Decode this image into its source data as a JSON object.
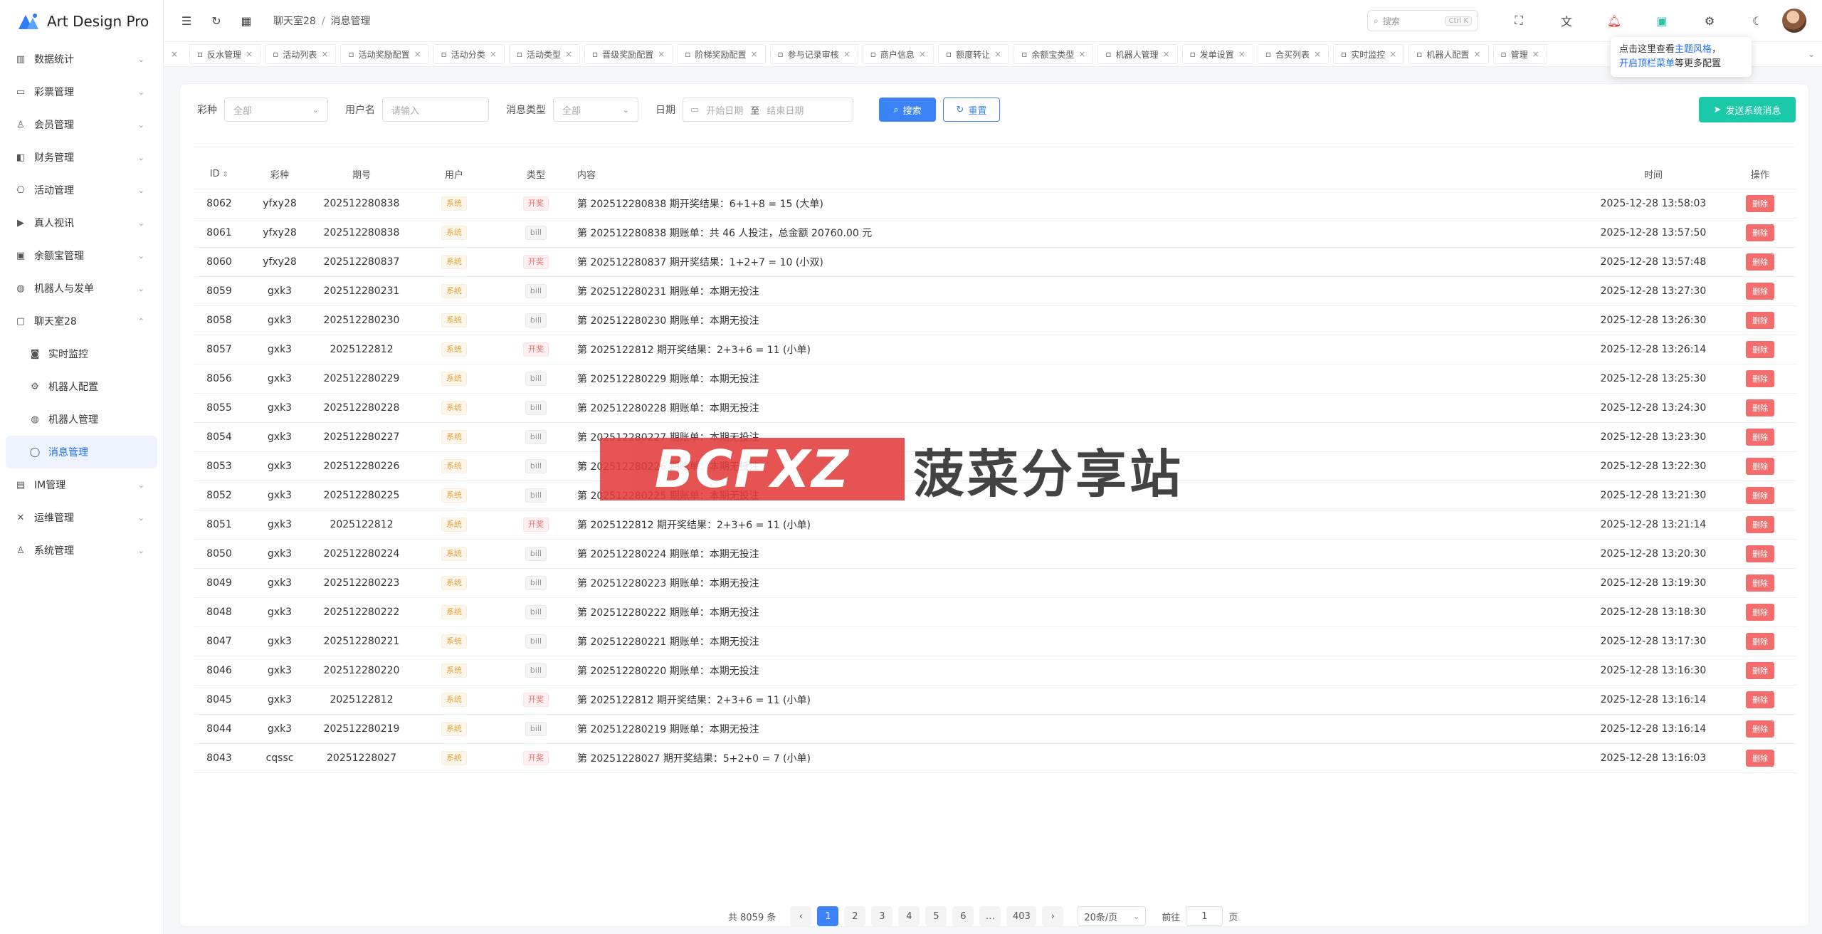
{
  "app": {
    "title": "Art Design Pro"
  },
  "sidebar": {
    "items": [
      {
        "label": "数据统计",
        "icon": "chart-icon",
        "expanded": false
      },
      {
        "label": "彩票管理",
        "icon": "ticket-icon",
        "expanded": false
      },
      {
        "label": "会员管理",
        "icon": "user-icon",
        "expanded": false
      },
      {
        "label": "财务管理",
        "icon": "wallet-icon",
        "expanded": false
      },
      {
        "label": "活动管理",
        "icon": "gift-icon",
        "expanded": false
      },
      {
        "label": "真人视讯",
        "icon": "video-icon",
        "expanded": false
      },
      {
        "label": "余额宝管理",
        "icon": "safe-icon",
        "expanded": false
      },
      {
        "label": "机器人与发单",
        "icon": "robot-icon",
        "expanded": false
      },
      {
        "label": "聊天室28",
        "icon": "chat-icon",
        "expanded": true
      }
    ],
    "sub_items": [
      {
        "label": "实时监控",
        "icon": "camera-icon"
      },
      {
        "label": "机器人配置",
        "icon": "gear-icon"
      },
      {
        "label": "机器人管理",
        "icon": "robot-icon"
      },
      {
        "label": "消息管理",
        "icon": "message-icon",
        "active": true
      }
    ],
    "items_after": [
      {
        "label": "IM管理",
        "icon": "im-icon"
      },
      {
        "label": "运维管理",
        "icon": "tools-icon"
      },
      {
        "label": "系统管理",
        "icon": "user-icon"
      }
    ]
  },
  "header": {
    "breadcrumb": [
      "聊天室28",
      "消息管理"
    ],
    "search_placeholder": "搜索",
    "search_shortcut": "Ctrl K"
  },
  "tabs": [
    {
      "label": "反水管理"
    },
    {
      "label": "活动列表"
    },
    {
      "label": "活动奖励配置"
    },
    {
      "label": "活动分类"
    },
    {
      "label": "活动类型"
    },
    {
      "label": "晋级奖励配置"
    },
    {
      "label": "阶梯奖励配置"
    },
    {
      "label": "参与记录审核"
    },
    {
      "label": "商户信息"
    },
    {
      "label": "额度转让"
    },
    {
      "label": "余额宝类型"
    },
    {
      "label": "机器人管理"
    },
    {
      "label": "发单设置"
    },
    {
      "label": "合买列表"
    },
    {
      "label": "实时监控"
    },
    {
      "label": "机器人配置"
    },
    {
      "label": "管理"
    }
  ],
  "tooltip": {
    "line1_prefix": "点击这里查看",
    "line1_link": "主题风格",
    "line1_suffix": "，",
    "line2_link": "开启顶栏菜单",
    "line2_suffix": "等更多配置"
  },
  "filters": {
    "lottery_label": "彩种",
    "lottery_value": "全部",
    "username_label": "用户名",
    "username_placeholder": "请输入",
    "type_label": "消息类型",
    "type_value": "全部",
    "date_label": "日期",
    "date_start": "开始日期",
    "date_sep": "至",
    "date_end": "结束日期",
    "search_button": "搜索",
    "reset_button": "重置",
    "send_button": "发送系统消息"
  },
  "table": {
    "columns": {
      "id": "ID",
      "lottery": "彩种",
      "period": "期号",
      "user": "用户",
      "type": "类型",
      "content": "内容",
      "time": "时间",
      "action": "操作"
    },
    "delete_label": "删除",
    "rows": [
      {
        "id": "8062",
        "lottery": "yfxy28",
        "period": "202512280838",
        "user": "系统",
        "type": "开奖",
        "type_kind": "open",
        "content": "第 202512280838 期开奖结果：6+1+8 = 15 (大单)",
        "time": "2025-12-28 13:58:03"
      },
      {
        "id": "8061",
        "lottery": "yfxy28",
        "period": "202512280838",
        "user": "系统",
        "type": "bill",
        "type_kind": "bill",
        "content": "第 202512280838 期账单：共 46 人投注，总金额 20760.00 元",
        "time": "2025-12-28 13:57:50"
      },
      {
        "id": "8060",
        "lottery": "yfxy28",
        "period": "202512280837",
        "user": "系统",
        "type": "开奖",
        "type_kind": "open",
        "content": "第 202512280837 期开奖结果：1+2+7 = 10 (小双)",
        "time": "2025-12-28 13:57:48"
      },
      {
        "id": "8059",
        "lottery": "gxk3",
        "period": "202512280231",
        "user": "系统",
        "type": "bill",
        "type_kind": "bill",
        "content": "第 202512280231 期账单：本期无投注",
        "time": "2025-12-28 13:27:30"
      },
      {
        "id": "8058",
        "lottery": "gxk3",
        "period": "202512280230",
        "user": "系统",
        "type": "bill",
        "type_kind": "bill",
        "content": "第 202512280230 期账单：本期无投注",
        "time": "2025-12-28 13:26:30"
      },
      {
        "id": "8057",
        "lottery": "gxk3",
        "period": "2025122812",
        "user": "系统",
        "type": "开奖",
        "type_kind": "open",
        "content": "第 2025122812 期开奖结果：2+3+6 = 11 (小单)",
        "time": "2025-12-28 13:26:14"
      },
      {
        "id": "8056",
        "lottery": "gxk3",
        "period": "202512280229",
        "user": "系统",
        "type": "bill",
        "type_kind": "bill",
        "content": "第 202512280229 期账单：本期无投注",
        "time": "2025-12-28 13:25:30"
      },
      {
        "id": "8055",
        "lottery": "gxk3",
        "period": "202512280228",
        "user": "系统",
        "type": "bill",
        "type_kind": "bill",
        "content": "第 202512280228 期账单：本期无投注",
        "time": "2025-12-28 13:24:30"
      },
      {
        "id": "8054",
        "lottery": "gxk3",
        "period": "202512280227",
        "user": "系统",
        "type": "bill",
        "type_kind": "bill",
        "content": "第 202512280227 期账单：本期无投注",
        "time": "2025-12-28 13:23:30"
      },
      {
        "id": "8053",
        "lottery": "gxk3",
        "period": "202512280226",
        "user": "系统",
        "type": "bill",
        "type_kind": "bill",
        "content": "第 202512280226 期账单：本期无投注",
        "time": "2025-12-28 13:22:30"
      },
      {
        "id": "8052",
        "lottery": "gxk3",
        "period": "202512280225",
        "user": "系统",
        "type": "bill",
        "type_kind": "bill",
        "content": "第 202512280225 期账单：本期无投注",
        "time": "2025-12-28 13:21:30"
      },
      {
        "id": "8051",
        "lottery": "gxk3",
        "period": "2025122812",
        "user": "系统",
        "type": "开奖",
        "type_kind": "open",
        "content": "第 2025122812 期开奖结果：2+3+6 = 11 (小单)",
        "time": "2025-12-28 13:21:14"
      },
      {
        "id": "8050",
        "lottery": "gxk3",
        "period": "202512280224",
        "user": "系统",
        "type": "bill",
        "type_kind": "bill",
        "content": "第 202512280224 期账单：本期无投注",
        "time": "2025-12-28 13:20:30"
      },
      {
        "id": "8049",
        "lottery": "gxk3",
        "period": "202512280223",
        "user": "系统",
        "type": "bill",
        "type_kind": "bill",
        "content": "第 202512280223 期账单：本期无投注",
        "time": "2025-12-28 13:19:30"
      },
      {
        "id": "8048",
        "lottery": "gxk3",
        "period": "202512280222",
        "user": "系统",
        "type": "bill",
        "type_kind": "bill",
        "content": "第 202512280222 期账单：本期无投注",
        "time": "2025-12-28 13:18:30"
      },
      {
        "id": "8047",
        "lottery": "gxk3",
        "period": "202512280221",
        "user": "系统",
        "type": "bill",
        "type_kind": "bill",
        "content": "第 202512280221 期账单：本期无投注",
        "time": "2025-12-28 13:17:30"
      },
      {
        "id": "8046",
        "lottery": "gxk3",
        "period": "202512280220",
        "user": "系统",
        "type": "bill",
        "type_kind": "bill",
        "content": "第 202512280220 期账单：本期无投注",
        "time": "2025-12-28 13:16:30"
      },
      {
        "id": "8045",
        "lottery": "gxk3",
        "period": "2025122812",
        "user": "系统",
        "type": "开奖",
        "type_kind": "open",
        "content": "第 2025122812 期开奖结果：2+3+6 = 11 (小单)",
        "time": "2025-12-28 13:16:14"
      },
      {
        "id": "8044",
        "lottery": "gxk3",
        "period": "202512280219",
        "user": "系统",
        "type": "bill",
        "type_kind": "bill",
        "content": "第 202512280219 期账单：本期无投注",
        "time": "2025-12-28 13:16:14"
      },
      {
        "id": "8043",
        "lottery": "cqssc",
        "period": "20251228027",
        "user": "系统",
        "type": "开奖",
        "type_kind": "open",
        "content": "第 20251228027 期开奖结果：5+2+0 = 7 (小单)",
        "time": "2025-12-28 13:16:03"
      }
    ]
  },
  "pagination": {
    "total_text": "共 8059 条",
    "pages": [
      "1",
      "2",
      "3",
      "4",
      "5",
      "6",
      "…",
      "403"
    ],
    "current": "1",
    "page_size": "20条/页",
    "goto_label": "前往",
    "goto_value": "1",
    "page_suffix": "页"
  },
  "watermark": {
    "logo_text": "BCFXZ",
    "text": "菠菜分享站"
  },
  "colors": {
    "primary": "#3b82f6",
    "success": "#19c9a8",
    "danger": "#f56c6c",
    "warning": "#e6a23c"
  }
}
